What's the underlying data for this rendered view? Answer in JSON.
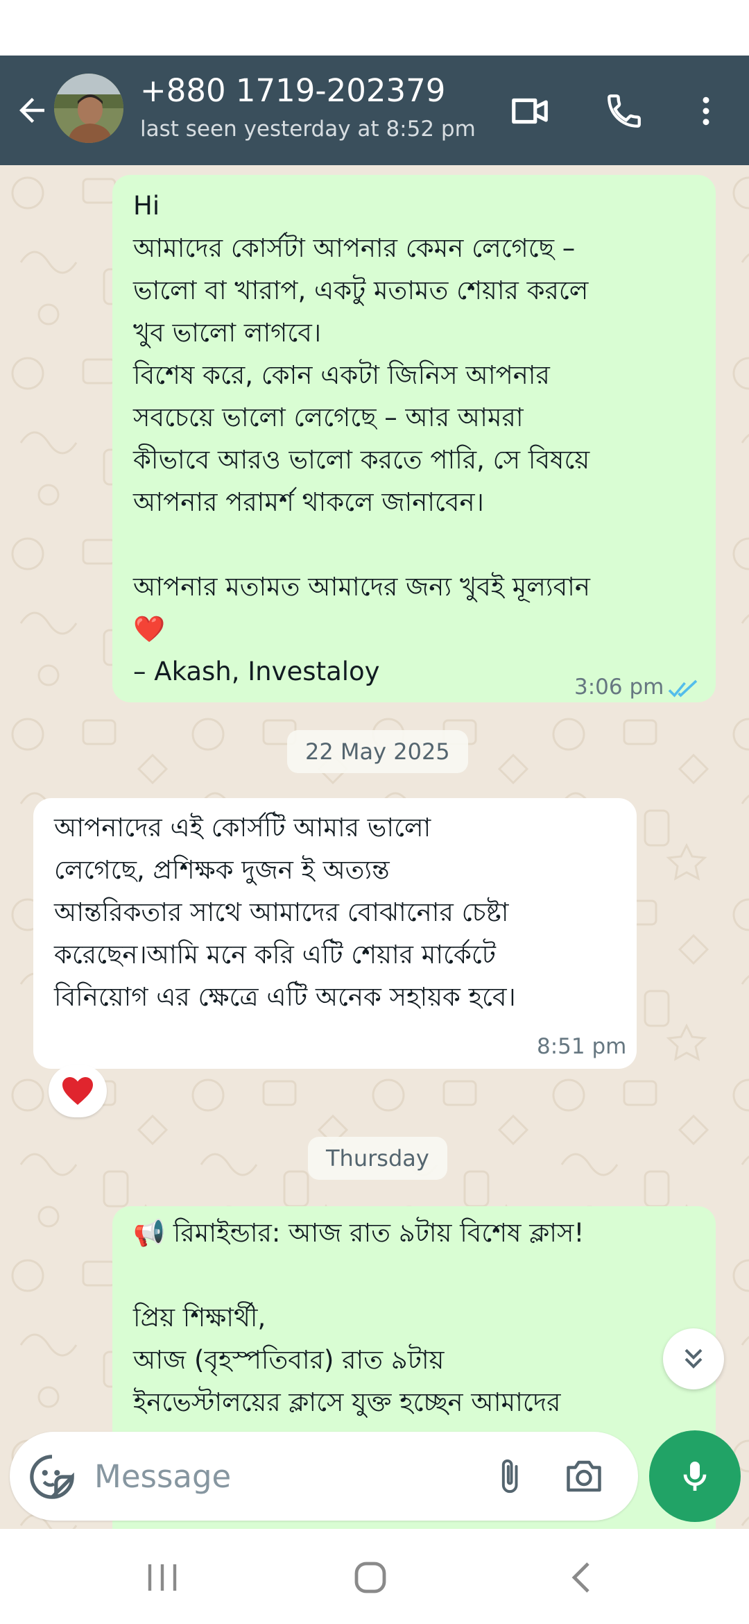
{
  "header": {
    "contact_name": "+880 1719-202379",
    "status": "last seen yesterday at 8:52 pm",
    "color": "#3a4f5c"
  },
  "messages": [
    {
      "direction": "outgoing",
      "text": "Hi\nআমাদের কোর্সটা আপনার কেমন লেগেছে –\nভালো বা খারাপ, একটু মতামত শেয়ার করলে\nখুব ভালো লাগবে।\nবিশেষ করে, কোন একটা জিনিস আপনার\nসবচেয়ে ভালো লেগেছে – আর আমরা\nকীভাবে আরও ভালো করতে পারি, সে বিষয়ে\nআপনার পরামর্শ থাকলে জানাবেন।\n\nআপনার মতামত আমাদের জন্য খুবই মূল্যবান\n❤️\n– Akash, Investaloy",
      "time": "3:06 pm",
      "status_icon": "double-check-icon"
    },
    {
      "direction": "incoming",
      "text": "আপনাদের এই কোর্সটি আমার ভালো\nলেগেছে, প্রশিক্ষক দুজন ই অত্যন্ত\nআন্তরিকতার সাথে আমাদের বোঝানোর চেষ্টা\nকরেছেন।আমি মনে করি এটি শেয়ার মার্কেটে\nবিনিয়োগ এর ক্ষেত্রে এটি অনেক সহায়ক হবে।",
      "time": "8:51 pm",
      "reaction": "❤️"
    },
    {
      "direction": "outgoing",
      "text": "📢 রিমাইন্ডার: আজ রাত ৯টায় বিশেষ ক্লাস!\n\nপ্রিয় শিক্ষার্থী,\nআজ (বৃহস্পতিবার) রাত ৯টায়\nইনভেস্টালয়ের ক্লাসে যুক্ত হচ্ছেন আমাদের"
    }
  ],
  "date_separators": [
    "22 May 2025",
    "Thursday"
  ],
  "composer": {
    "placeholder": "Message"
  },
  "colors": {
    "outgoing_bubble": "#d9fdd3",
    "incoming_bubble": "#ffffff",
    "chat_background": "#efe7dc",
    "mic_button": "#21a366",
    "read_tick": "#53bdeb"
  }
}
